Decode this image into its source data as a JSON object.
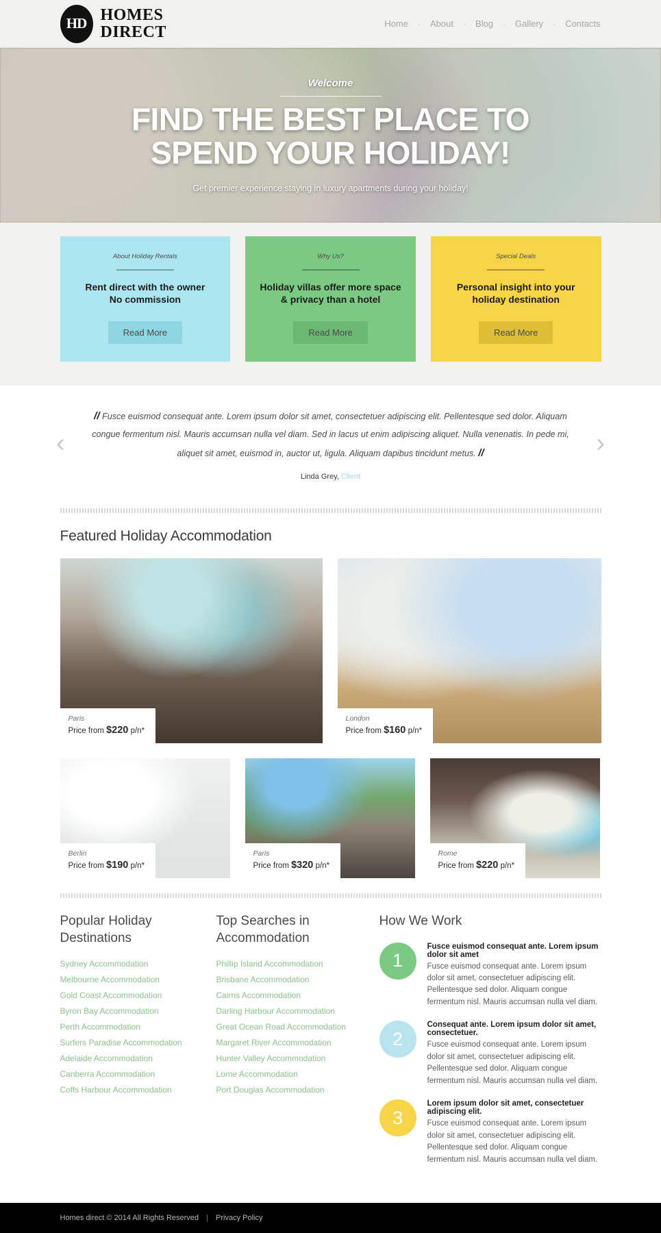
{
  "header": {
    "logo_mark": "HD",
    "logo_line1": "HOMES",
    "logo_line2": "DIRECT",
    "nav": [
      {
        "label": "Home"
      },
      {
        "label": "About"
      },
      {
        "label": "Blog"
      },
      {
        "label": "Gallery"
      },
      {
        "label": "Contacts"
      }
    ],
    "nav_separator": "·"
  },
  "hero": {
    "welcome": "Welcome",
    "title_line1": "FIND THE BEST PLACE TO",
    "title_line2": "SPEND YOUR HOLIDAY!",
    "subtitle": "Get premier experience staying in luxury apartments during your holiday!"
  },
  "features": [
    {
      "title": "About Holiday Rentals",
      "text_line1": "Rent direct with the owner",
      "text_line2": "No commission",
      "button": "Read More",
      "bg": "#ace6f0",
      "btn_bg": "#8fd6e3"
    },
    {
      "title": "Why Us?",
      "text_line1": "Holiday villas offer more space",
      "text_line2": "& privacy than a hotel",
      "button": "Read More",
      "bg": "#7bc982",
      "btn_bg": "#6bb873"
    },
    {
      "title": "Special Deals",
      "text_line1": "Personal insight into your",
      "text_line2": "holiday destination",
      "button": "Read More",
      "bg": "#f6d548",
      "btn_bg": "#ddbe34"
    }
  ],
  "testimonial": {
    "open_mark": "//",
    "close_mark": "//",
    "quote": "Fusce euismod consequat ante. Lorem ipsum dolor sit amet, consectetuer adipiscing elit. Pellentesque sed dolor. Aliquam congue fermentum nisl. Mauris accumsan nulla vel diam. Sed in lacus ut enim adipiscing aliquet. Nulla venenatis. In pede mi, aliquet sit amet, euismod in, auctor ut, ligula. Aliquam dapibus tincidunt metus.",
    "author": "Linda Grey,",
    "role": "Client",
    "prev_arrow": "‹",
    "next_arrow": "›"
  },
  "featured": {
    "title": "Featured Holiday Accommodation",
    "price_prefix": "Price from",
    "price_suffix": "p/n*",
    "cards_top": [
      {
        "city": "Paris",
        "price": "$220"
      },
      {
        "city": "London",
        "price": "$160"
      }
    ],
    "cards_bottom": [
      {
        "city": "Berlin",
        "price": "$190"
      },
      {
        "city": "Paris",
        "price": "$320"
      },
      {
        "city": "Rome",
        "price": "$220"
      }
    ]
  },
  "destinations": {
    "title_line1": "Popular Holiday",
    "title_line2": "Destinations",
    "links": [
      "Sydney Accommodation",
      "Melbourne Accommodation",
      "Gold Coast Accommodation",
      "Byron Bay Accommodation",
      "Perth Accommodation",
      "Surfers Paradise Accommodation",
      "Adelaide Accommodation",
      "Canberra Accommodation",
      "Coffs Harbour Accommodation"
    ]
  },
  "searches": {
    "title_line1": "Top Searches in",
    "title_line2": "Accommodation",
    "links": [
      "Phillip Island Accommodation",
      "Brisbane Accommodation",
      "Cairns Accommodation",
      "Darling Harbour Accommodation",
      "Great Ocean Road Accommodation",
      "Margaret River Accommodation",
      "Hunter Valley Accommodation",
      "Lorne Accommodation",
      "Port Douglas Accommodation"
    ]
  },
  "how_we_work": {
    "title": "How We Work",
    "steps": [
      {
        "number": "1",
        "color": "#7bc982",
        "title": "Fusce euismod consequat ante. Lorem ipsum dolor sit amet",
        "text": "Fusce euismod consequat ante. Lorem ipsum dolor sit amet, consectetuer adipiscing elit. Pellentesque sed dolor. Aliquam congue fermentum nisl. Mauris accumsan nulla vel diam."
      },
      {
        "number": "2",
        "color": "#b8e4ee",
        "title": "Consequat ante. Lorem ipsum dolor sit amet, consectetuer.",
        "text": "Fusce euismod consequat ante. Lorem ipsum dolor sit amet, consectetuer adipiscing elit. Pellentesque sed dolor. Aliquam congue fermentum nisl. Mauris accumsan nulla vel diam."
      },
      {
        "number": "3",
        "color": "#f6d548",
        "title": "Lorem ipsum dolor sit amet, consectetuer adipiscing elit.",
        "text": "Fusce euismod consequat ante. Lorem ipsum dolor sit amet, consectetuer adipiscing elit. Pellentesque sed dolor. Aliquam congue fermentum nisl. Mauris accumsan nulla vel diam."
      }
    ]
  },
  "footer": {
    "copyright": "Homes direct © 2014 All Rights Reserved",
    "separator": "|",
    "privacy": "Privacy Policy"
  }
}
